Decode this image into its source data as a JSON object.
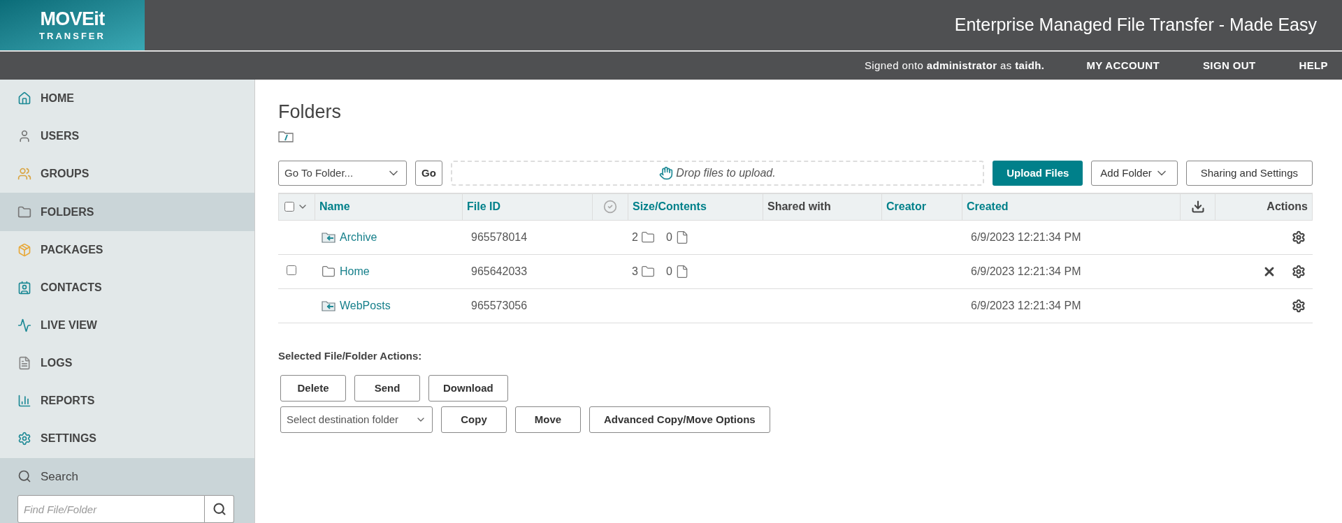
{
  "header": {
    "logo_line_1": "MOVEit",
    "logo_line_2": "TRANSFER",
    "tagline": "Enterprise Managed File Transfer - Made Easy"
  },
  "top_nav": {
    "signed_in": "Signed onto **administrator** as **taidh.**",
    "links": [
      "MY ACCOUNT",
      "SIGN OUT",
      "HELP"
    ]
  },
  "sidebar": {
    "items": [
      {
        "label": "HOME",
        "selected": false
      },
      {
        "label": "USERS",
        "selected": false
      },
      {
        "label": "GROUPS",
        "selected": false
      },
      {
        "label": "FOLDERS",
        "selected": true
      },
      {
        "label": "PACKAGES",
        "selected": false
      },
      {
        "label": "CONTACTS",
        "selected": false
      },
      {
        "label": "LIVE VIEW",
        "selected": false
      },
      {
        "label": "LOGS",
        "selected": false
      },
      {
        "label": "REPORTS",
        "selected": false
      },
      {
        "label": "SETTINGS",
        "selected": false
      }
    ],
    "search": {
      "label": "Search",
      "placeholder": "Find File/Folder"
    }
  },
  "page": {
    "title": "Folders"
  },
  "toolbar": {
    "go_to_folder": "Go To Folder...",
    "go": "Go",
    "drop_zone": "Drop files to upload.",
    "upload": "Upload Files",
    "add_folder": "Add Folder",
    "sharing": "Sharing and Settings"
  },
  "table": {
    "all_checked": false,
    "columns": [
      {
        "label": "Name",
        "sortable": true
      },
      {
        "label": "File ID",
        "sortable": true
      },
      {
        "label": "Size/Contents",
        "sortable": true
      },
      {
        "label": "Shared with",
        "sortable": false
      },
      {
        "label": "Creator",
        "sortable": true
      },
      {
        "label": "Created",
        "sortable": true
      },
      {
        "label": "Actions",
        "sortable": false
      }
    ],
    "rows": [
      {
        "kind": "system",
        "name": "Archive",
        "file_id": "965578014",
        "folders": "2",
        "files": "0",
        "created": "6/9/2023 12:21:34 PM",
        "selectable": false,
        "deletable": false
      },
      {
        "kind": "folder",
        "name": "Home",
        "file_id": "965642033",
        "folders": "3",
        "files": "0",
        "created": "6/9/2023 12:21:34 PM",
        "selectable": true,
        "deletable": true
      },
      {
        "kind": "system",
        "name": "WebPosts",
        "file_id": "965573056",
        "created": "6/9/2023 12:21:34 PM",
        "selectable": false,
        "deletable": false
      }
    ]
  },
  "selected_actions": {
    "title": "Selected File/Folder Actions:",
    "buttons": [
      "Delete",
      "Send",
      "Download"
    ],
    "destination": "Select destination folder",
    "buttons_2": [
      "Copy",
      "Move",
      "Advanced Copy/Move Options"
    ]
  }
}
